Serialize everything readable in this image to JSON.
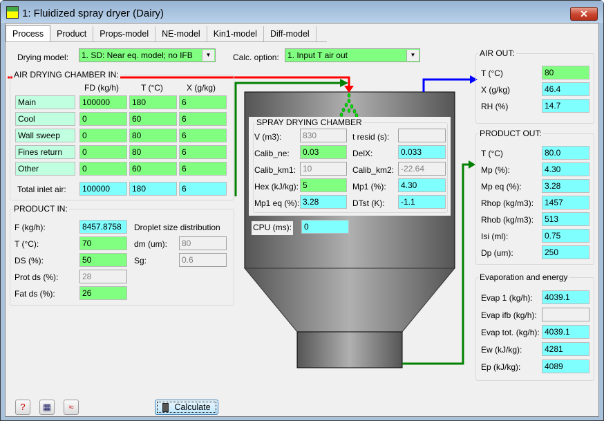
{
  "window": {
    "title": "1: Fluidized spray dryer (Dairy)",
    "close_label": "✕"
  },
  "tabs": [
    "Process",
    "Product",
    "Props-model",
    "NE-model",
    "Kin1-model",
    "Diff-model"
  ],
  "controls": {
    "drying_model_label": "Drying model:",
    "drying_model_value": "1. SD: Near eq. model; no IFB",
    "calc_option_label": "Calc. option:",
    "calc_option_value": "1. Input T air out"
  },
  "air_in": {
    "title": "AIR DRYING CHAMBER IN:",
    "headers": [
      "FD (kg/h)",
      "T (°C)",
      "X (g/kg)"
    ],
    "rows": [
      {
        "name": "Main",
        "fd": "100000",
        "t": "180",
        "x": "6"
      },
      {
        "name": "Cool",
        "fd": "0",
        "t": "60",
        "x": "6"
      },
      {
        "name": "Wall sweep",
        "fd": "0",
        "t": "80",
        "x": "6"
      },
      {
        "name": "Fines return",
        "fd": "0",
        "t": "80",
        "x": "6"
      },
      {
        "name": "Other",
        "fd": "0",
        "t": "60",
        "x": "6"
      }
    ],
    "total_label": "Total inlet air:",
    "total_fd": "100000",
    "total_t": "180",
    "total_x": "6"
  },
  "product_in": {
    "title": "PRODUCT IN:",
    "f_label": "F (kg/h):",
    "f": "8457.8758",
    "t_label": "T (°C):",
    "t": "70",
    "ds_label": "DS (%):",
    "ds": "50",
    "prot_label": "Prot ds (%):",
    "prot": "28",
    "fat_label": "Fat ds (%):",
    "fat": "26",
    "dsd_label": "Droplet size distribution",
    "dm_label": "dm (um):",
    "dm": "80",
    "sg_label": "Sg:",
    "sg": "0.6"
  },
  "chamber": {
    "title": "SPRAY DRYING CHAMBER",
    "v_label": "V (m3):",
    "v": "830",
    "tresid_label": "t resid (s):",
    "tresid": "",
    "calib_ne_label": "Calib_ne:",
    "calib_ne": "0.03",
    "delx_label": "DelX:",
    "delx": "0.033",
    "calib_km1_label": "Calib_km1:",
    "calib_km1": "10",
    "calib_km2_label": "Calib_km2:",
    "calib_km2": "-22.64",
    "hex_label": "Hex (kJ/kg):",
    "hex": "5",
    "mp1_label": "Mp1 (%):",
    "mp1": "4.30",
    "mp1eq_label": "Mp1 eq (%):",
    "mp1eq": "3.28",
    "dtst_label": "DTst (K):",
    "dtst": "-1.1",
    "cpu_label": "CPU (ms):",
    "cpu": "0"
  },
  "air_out": {
    "title": "AIR OUT:",
    "t_label": "T (°C)",
    "t": "80",
    "x_label": "X (g/kg)",
    "x": "46.4",
    "rh_label": "RH (%)",
    "rh": "14.7"
  },
  "product_out": {
    "title": "PRODUCT OUT:",
    "items": [
      {
        "label": "T (°C)",
        "value": "80.0"
      },
      {
        "label": "Mp (%):",
        "value": "4.30"
      },
      {
        "label": "Mp eq (%):",
        "value": "3.28"
      },
      {
        "label": "Rhop (kg/m3):",
        "value": "1457"
      },
      {
        "label": "Rhob (kg/m3):",
        "value": "513"
      },
      {
        "label": "Isi (ml):",
        "value": "0.75"
      },
      {
        "label": "Dp (um):",
        "value": "250"
      }
    ]
  },
  "evap": {
    "title": "Evaporation and energy",
    "items": [
      {
        "label": "Evap 1 (kg/h):",
        "value": "4039.1"
      },
      {
        "label": "Evap ifb (kg/h):",
        "value": ""
      },
      {
        "label": "Evap tot. (kg/h):",
        "value": "4039.1"
      },
      {
        "label": "Ew (kJ/kg):",
        "value": "4281"
      },
      {
        "label": "Ep (kJ/kg):",
        "value": "4089"
      }
    ]
  },
  "footer": {
    "calculate_label": "Calculate"
  },
  "colors": {
    "input": "#80ff80",
    "output": "#80ffff",
    "air_in_arrow": "#ff0000",
    "product_arrow": "#008000",
    "air_out_arrow": "#0000ff"
  }
}
